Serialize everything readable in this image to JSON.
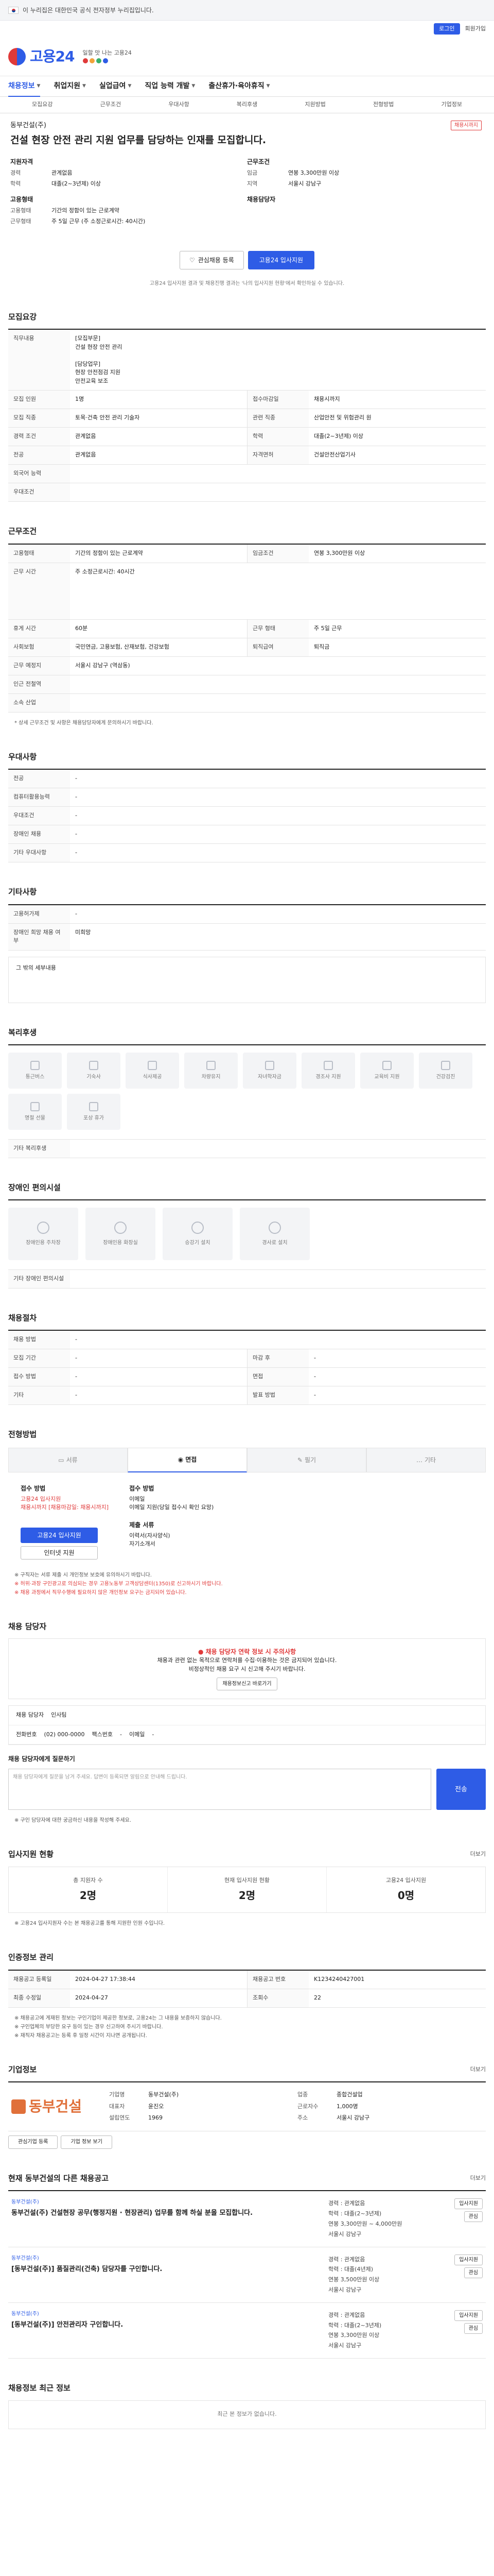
{
  "gov_banner": "이 누리집은 대한민국 공식 전자정부 누리집입니다.",
  "util": {
    "login": "로그인",
    "join": "회원가입"
  },
  "brand": {
    "logo": "고용24",
    "sub": "일할 맛 나는 고용24",
    "dot_colors": [
      "#e03a3a",
      "#f2a33a",
      "#3ab06a",
      "#2e5ce6"
    ]
  },
  "nav": [
    "채용정보",
    "취업지원",
    "실업급여",
    "직업 능력 개발",
    "출산휴가·육아휴직"
  ],
  "subtabs": [
    "모집요강",
    "근무조건",
    "우대사항",
    "복리후생",
    "지원방법",
    "전형방법",
    "기업정보"
  ],
  "job": {
    "company": "동부건설(주)",
    "title": "건설 현장 안전 관리 지원 업무를 담당하는 인재를 모집합니다.",
    "badge": "채용시까지",
    "summary": {
      "left_h": "지원자격",
      "left": [
        {
          "k": "경력",
          "v": "관계없음"
        },
        {
          "k": "학력",
          "v": "대졸(2~3년제) 이상"
        }
      ],
      "left_h2": "고용형태",
      "left2": [
        {
          "k": "고용형태",
          "v": "기간의 정함이 있는 근로계약"
        },
        {
          "k": "근무형태",
          "v": "주 5일 근무 (주 소정근로시간: 40시간)"
        }
      ],
      "right_h": "근무조건",
      "right": [
        {
          "k": "임금",
          "v": "연봉 3,300만원 이상"
        },
        {
          "k": "지역",
          "v": "서울시 강남구"
        }
      ],
      "right_h2": "채용담당자",
      "right2": []
    },
    "btn_interest": "관심채용 등록",
    "btn_apply": "고용24 입사지원",
    "apply_note": "고용24 입사지원 결과 및 채용진행 결과는 '나의 입사지원 현황'에서 확인하실 수 있습니다."
  },
  "sections": {
    "recruit": {
      "h": "모집요강",
      "duty_h": "직무내용",
      "duty": "[모집부문]\n건설 현장 안전 관리\n\n[담당업무]\n현장 안전점검 지원\n안전교육 보조",
      "rows": [
        {
          "k": "모집 인원",
          "v": "1명",
          "k2": "접수마감일",
          "v2": "채용시까지"
        },
        {
          "k": "모집 직종",
          "v": "토목·건축 안전 관리 기술자",
          "k2": "관련 직종",
          "v2": "산업안전 및 위험관리 원"
        },
        {
          "k": "경력 조건",
          "v": "관계없음",
          "k2": "학력",
          "v2": "대졸(2~3년제) 이상"
        },
        {
          "k": "전공",
          "v": "관계없음",
          "k2": "자격면허",
          "v2": "건설안전산업기사"
        },
        {
          "k": "외국어 능력",
          "v": "",
          "k2": "",
          "v2": ""
        },
        {
          "k": "우대조건",
          "v": "",
          "k2": "",
          "v2": ""
        }
      ]
    },
    "work": {
      "h": "근무조건",
      "rows": [
        {
          "k": "고용형태",
          "v": "기간의 정함이 있는 근로계약",
          "k2": "임금조건",
          "v2": "연봉 3,300만원 이상"
        },
        {
          "k": "근무 시간",
          "v": "주 소정근로시간: 40시간",
          "k2": "",
          "v2": ""
        },
        {
          "k": "휴게 시간",
          "v": "60분",
          "k2": "근무 형태",
          "v2": "주 5일 근무"
        },
        {
          "k": "사회보험",
          "v": "국민연금, 고용보험, 산재보험, 건강보험",
          "k2": "퇴직급여",
          "v2": "퇴직금"
        },
        {
          "k": "근무 예정지",
          "v": "서울시 강남구 (역삼동)",
          "k2": "",
          "v2": ""
        },
        {
          "k": "인근 전철역",
          "v": "",
          "k2": "",
          "v2": ""
        },
        {
          "k": "소속 산업",
          "v": "",
          "k2": "",
          "v2": ""
        }
      ],
      "note": "* 상세 근무조건 및 사항은 채용담당자에게 문의하시기 바랍니다."
    },
    "prefer": {
      "h": "우대사항",
      "rows": [
        {
          "k": "전공",
          "v": "-"
        },
        {
          "k": "컴퓨터활용능력",
          "v": "-"
        },
        {
          "k": "우대조건",
          "v": "-"
        },
        {
          "k": "장애인 채용",
          "v": "-"
        },
        {
          "k": "기타 우대사항",
          "v": "-"
        }
      ]
    },
    "other": {
      "h": "기타사항",
      "rows": [
        {
          "k": "고용허가제",
          "v": "-"
        },
        {
          "k": "장애인 희망 채용 여부",
          "v": "미희망"
        }
      ],
      "detail": "그 밖의 세부내용"
    },
    "welfare": {
      "h": "복리후생",
      "tiles": [
        "통근버스",
        "기숙사",
        "식사제공",
        "차량유지",
        "자녀학자금",
        "경조사 지원",
        "교육비 지원",
        "건강검진",
        "명절 선물",
        "포상 휴가"
      ],
      "etc_h": "기타 복리후생"
    },
    "disabled": {
      "h": "장애인 편의시설",
      "tiles": [
        "장애인용 주차장",
        "장애인용 화장실",
        "승강기 설치",
        "경사로 설치"
      ],
      "etc_h": "기타 장애인 편의시설"
    },
    "recruit_proc": {
      "h": "채용절차",
      "rows": [
        {
          "k": "채용 방법",
          "v": "-",
          "k2": "",
          "v2": ""
        },
        {
          "k": "모집 기간",
          "v": "-",
          "k2": "마감 후",
          "v2": "-"
        },
        {
          "k": "접수 방법",
          "v": "-",
          "k2": "면접",
          "v2": "-"
        },
        {
          "k": "기타",
          "v": "-",
          "k2": "발표 방법",
          "v2": "-"
        }
      ]
    },
    "apply": {
      "h": "전형방법",
      "tabs": [
        "서류",
        "면접",
        "필기",
        "기타"
      ],
      "col1_h": "접수 방법",
      "col1": "고용24 입사지원\n채용시까지 [채용마감일: 채용시까지]",
      "col2_h": "접수 방법",
      "col2": "이메일\n이메일 지원(당일 접수시 확인 요망)",
      "col3_h": "제출 서류",
      "col3": "이력서(자사양식)\n자기소개서",
      "btn1": "고용24 입사지원",
      "btn2": "인터넷 지원",
      "notes": [
        "※ 구직자는 서류 제출 시 개인정보 보호에 유의하시기 바랍니다.",
        "※ 허위·과장 구인광고로 의심되는 경우 고용노동부 고객상담센터(1350)로 신고하시기 바랍니다.",
        "※ 채용 과정에서 직무수행에 필요하지 않은 개인정보 요구는 금지되어 있습니다."
      ]
    },
    "contact": {
      "h": "채용 담당자",
      "warn1": "채용 담당자 연락 정보 시 주의사항",
      "warn2": "채용과 관련 없는 목적으로 연락처를 수집·이용하는 것은 금지되어 있습니다.",
      "warn3": "비정상적인 채용 요구 시 신고해 주시기 바랍니다.",
      "warn_btn": "채용정보신고 바로가기",
      "name_k": "채용 담당자",
      "name_v": "인사팀",
      "tel_k": "전화번호",
      "tel_v": "(02) 000-0000",
      "fax_k": "팩스번호",
      "fax_v": "-",
      "email_k": "이메일",
      "email_v": "-",
      "memo_h": "채용 담당자에게 질문하기",
      "memo_placeholder": "채용 담당자에게 질문을 남겨 주세요. 답변이 등록되면 알림으로 안내해 드립니다.",
      "memo_btn": "전송",
      "memo_note": "※ 구인 담당자에 대한 궁금하신 내용을 작성해 주세요."
    },
    "apply_stat": {
      "h": "입사지원 현황",
      "more": "더보기",
      "stats": [
        {
          "lbl": "총 지원자 수",
          "num": "2명"
        },
        {
          "lbl": "현재 입사지원 현황",
          "num": "2명"
        },
        {
          "lbl": "고용24 입사지원",
          "num": "0명"
        }
      ],
      "note": "※ 고용24 입사지원자 수는 본 채용공고를 통해 지원한 인원 수입니다."
    },
    "manage": {
      "h": "인증정보 관리",
      "rows": [
        {
          "k": "채용공고 등록일",
          "v": "2024-04-27 17:38:44",
          "k2": "채용공고 번호",
          "v2": "K1234240427001"
        },
        {
          "k": "최종 수정일",
          "v": "2024-04-27",
          "k2": "조회수",
          "v2": "22"
        }
      ],
      "notes": [
        "※ 채용공고에 게재된 정보는 구인기업이 제공한 정보로, 고용24는 그 내용을 보증하지 않습니다.",
        "※ 구인업체의 부당한 요구 등이 있는 경우 신고하여 주시기 바랍니다.",
        "※ 재직자 채용공고는 등록 후 일정 시간이 지나면 공개됩니다."
      ]
    },
    "company": {
      "h": "기업정보",
      "more": "더보기",
      "logo": "동부건설",
      "info": [
        {
          "k": "기업명",
          "v": "동부건설(주)"
        },
        {
          "k": "업종",
          "v": "종합건설업"
        },
        {
          "k": "대표자",
          "v": "윤진오"
        },
        {
          "k": "근로자수",
          "v": "1,000명"
        },
        {
          "k": "설립연도",
          "v": "1969"
        },
        {
          "k": "주소",
          "v": "서울시 강남구"
        }
      ],
      "btn1": "관심기업 등록",
      "btn2": "기업 정보 보기"
    },
    "other_jobs": {
      "h": "현재 동부건설의 다른 채용공고",
      "more": "더보기",
      "items": [
        {
          "co": "동부건설(주)",
          "title": "동부건설(주) 건설현장 공무(행정지원 · 현장관리) 업무를 함께 하실 분을 모집합니다.",
          "m1": "경력 : 관계없음",
          "m2": "학력 : 대졸(2~3년제)",
          "m3": "연봉 3,300만원 ~ 4,000만원",
          "m4": "서울시 강남구",
          "r1": "입사지원",
          "r2": "관심"
        },
        {
          "co": "동부건설(주)",
          "title": "[동부건설(주)] 품질관리(건축) 담당자를 구인합니다.",
          "m1": "경력 : 관계없음",
          "m2": "학력 : 대졸(4년제)",
          "m3": "연봉 3,500만원 이상",
          "m4": "서울시 강남구",
          "r1": "입사지원",
          "r2": "관심"
        },
        {
          "co": "동부건설(주)",
          "title": "[동부건설(주)] 안전관리자 구인합니다.",
          "m1": "경력 : 관계없음",
          "m2": "학력 : 대졸(2~3년제)",
          "m3": "연봉 3,300만원 이상",
          "m4": "서울시 강남구",
          "r1": "입사지원",
          "r2": "관심"
        }
      ]
    },
    "recent": {
      "h": "채용정보 최근 정보",
      "empty": "최근 본 정보가 없습니다."
    }
  }
}
